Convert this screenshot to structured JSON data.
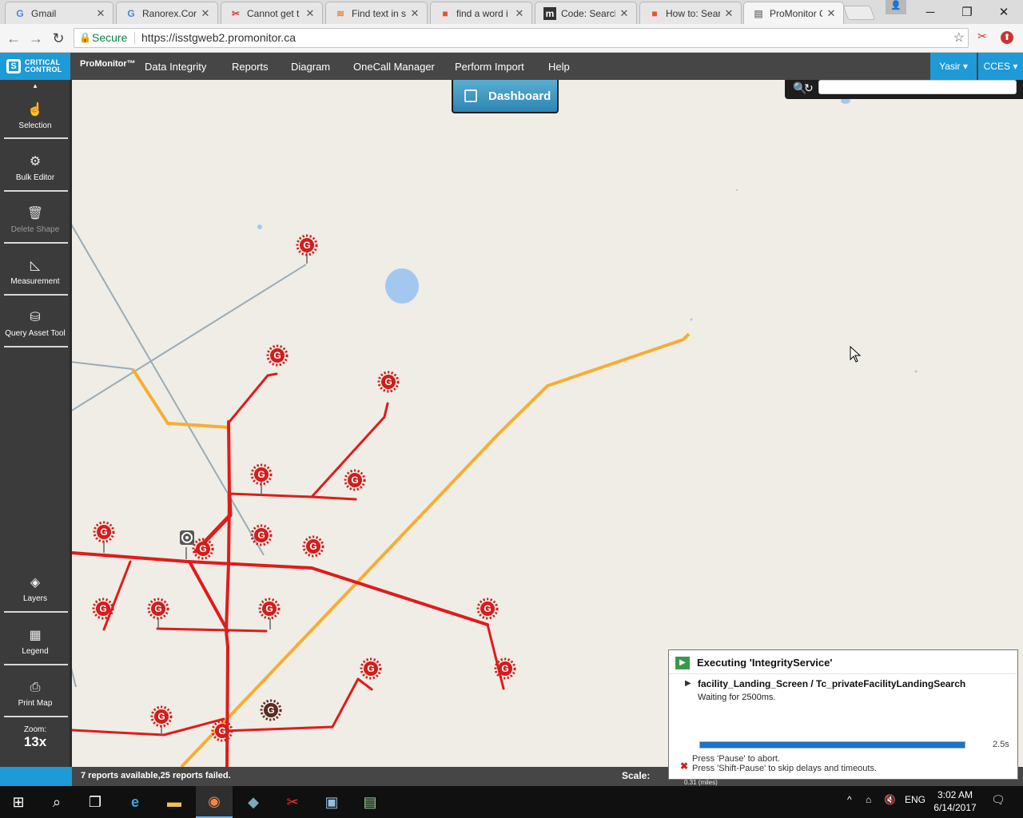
{
  "browser": {
    "tabs": [
      {
        "title": "Gmail"
      },
      {
        "title": "Ranorex.Core"
      },
      {
        "title": "Cannot get t"
      },
      {
        "title": "Find text in s"
      },
      {
        "title": "find a word i"
      },
      {
        "title": "Code: Search"
      },
      {
        "title": "How to: Sear"
      },
      {
        "title": "ProMonitor C"
      }
    ],
    "secure_label": "Secure",
    "url": "https://isstgweb2.promonitor.ca"
  },
  "app": {
    "brand": "ProMonitor™",
    "menu": [
      "Data Integrity",
      "Reports",
      "Diagram",
      "OneCall Manager",
      "Perform Import",
      "Help"
    ],
    "user": "Yasir",
    "company": "CCES"
  },
  "map": {
    "dashboard_label": "Dashboard"
  },
  "sidebar": {
    "tools": [
      "Selection",
      "Bulk Editor",
      "Delete Shape",
      "Measurement",
      "Query Asset Tool",
      "Layers",
      "Legend",
      "Print Map"
    ],
    "zoom_label": "Zoom:",
    "zoom_value": "13x"
  },
  "status": {
    "reports": "7 reports available,25 reports failed.",
    "scale_label": "Scale:",
    "scale_value": "0.31 (miles)"
  },
  "popup": {
    "title": "Executing 'IntegrityService'",
    "step": "facility_Landing_Screen / Tc_privateFacilityLandingSearch",
    "wait_text": "Waiting for 2500ms.",
    "progress": 1.0,
    "time": "2.5s",
    "hint1": "Press 'Pause' to abort.",
    "hint2": "Press 'Shift-Pause' to skip delays and timeouts."
  },
  "taskbar": {
    "lang": "ENG",
    "time": "3:02 AM",
    "date": "6/14/2017"
  },
  "colors": {
    "accent": "#1e9ad6",
    "header_bg": "#464646",
    "pipeline_red": "#e01b1b",
    "pipeline_orange": "#f7ad34",
    "map_bg": "#efede5"
  }
}
